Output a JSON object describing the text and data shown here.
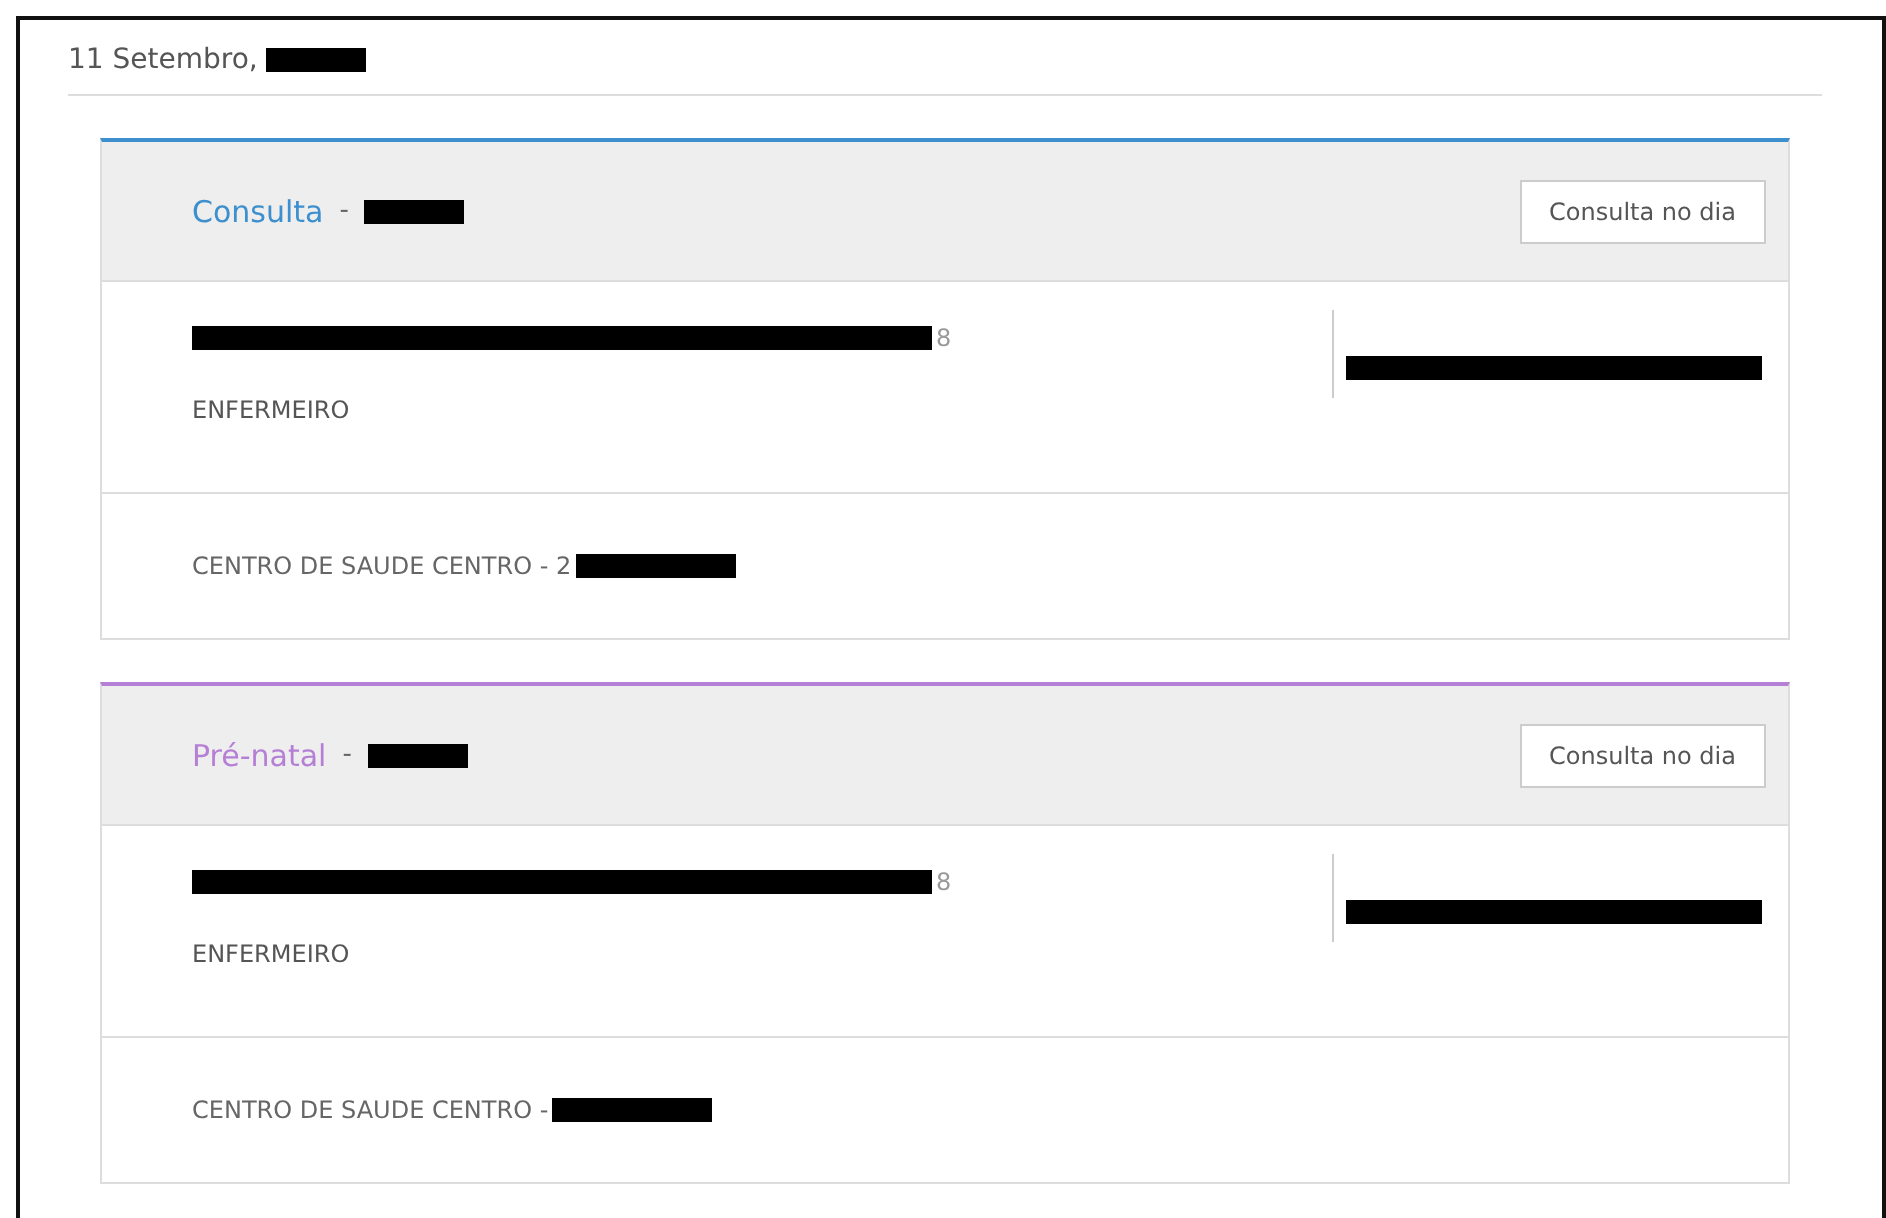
{
  "date": {
    "text": "11 Setembro,",
    "redacted": true
  },
  "appointments": [
    {
      "title": "Consulta",
      "color": "#3d8fce",
      "separator": "-",
      "code_redacted": true,
      "button": "Consulta no dia",
      "professional": {
        "text": "8",
        "redacted": true
      },
      "contact_redacted": true,
      "role": "ENFERMEIRO",
      "location": {
        "text": "CENTRO DE SAUDE CENTRO - 2",
        "redacted": true
      }
    },
    {
      "title": "Pré-natal",
      "color": "#b57fd6",
      "separator": "-",
      "code_redacted": true,
      "button": "Consulta no dia",
      "professional": {
        "text": "8",
        "redacted": true
      },
      "contact_redacted": true,
      "role": "ENFERMEIRO",
      "location": {
        "text": "CENTRO DE SAUDE CENTRO -",
        "redacted": true
      }
    }
  ]
}
